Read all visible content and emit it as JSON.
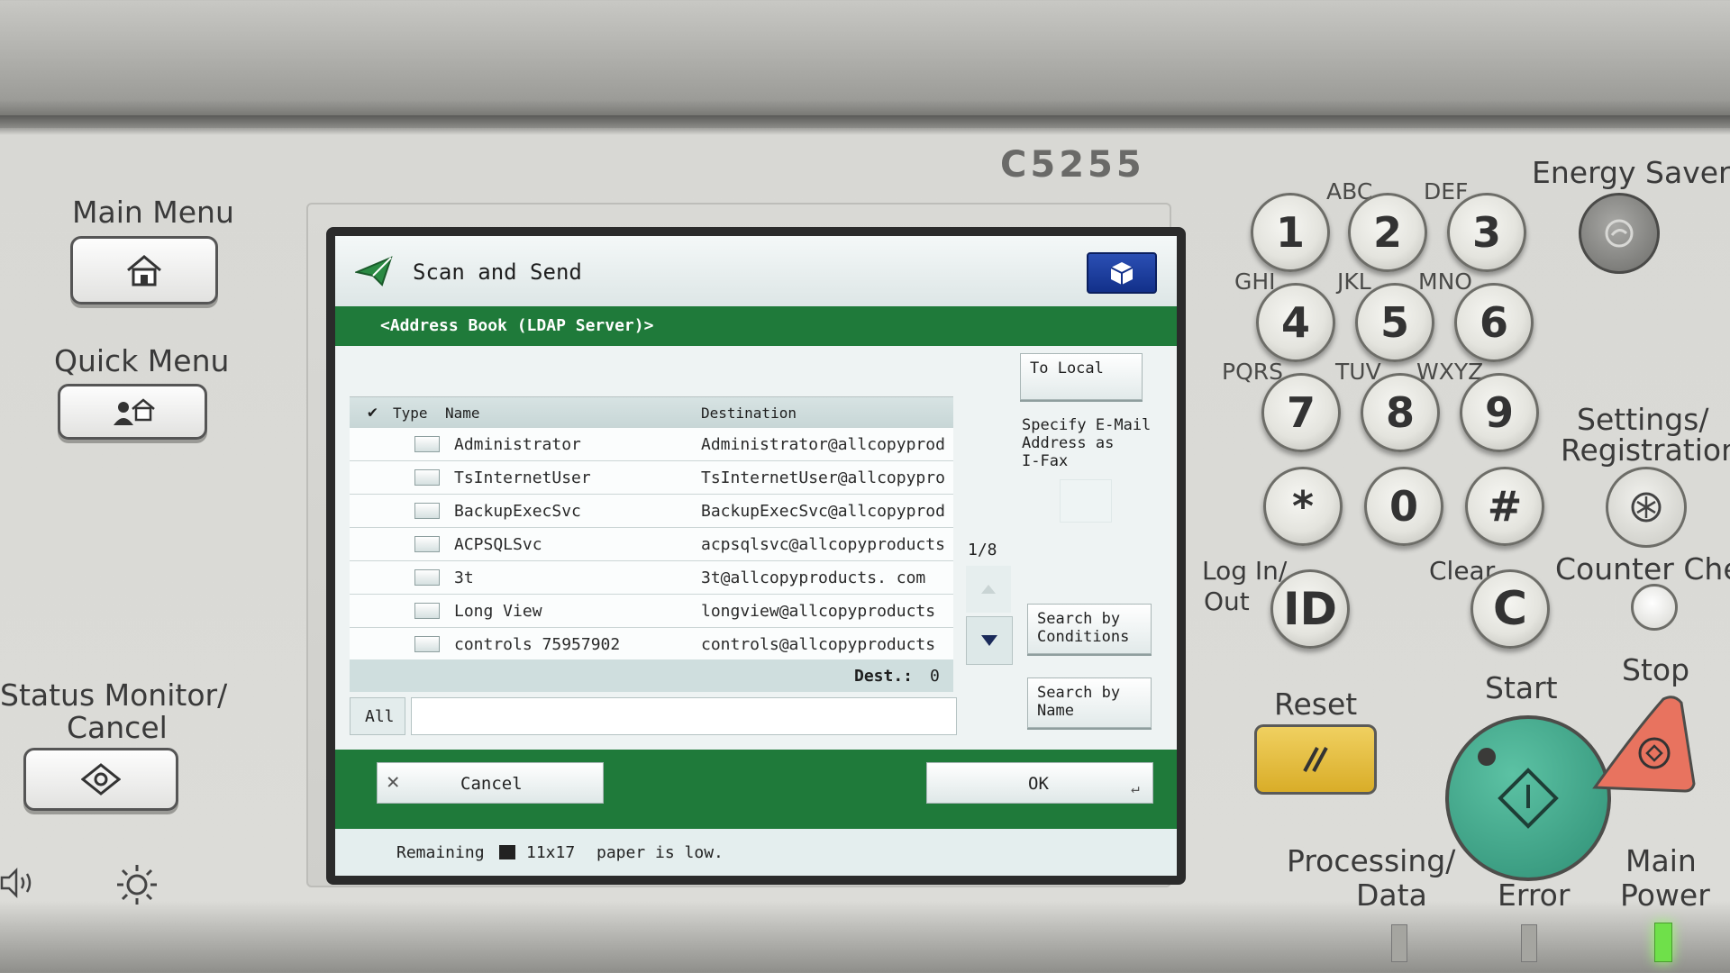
{
  "model": "C5255",
  "left_panel": {
    "main_menu": "Main Menu",
    "quick_menu": "Quick Menu",
    "status_monitor": "Status Monitor/",
    "status_cancel": "Cancel"
  },
  "screen": {
    "title": "Scan and Send",
    "section": "<Address Book (LDAP Server)>",
    "columns": {
      "check": "✔",
      "type": "Type",
      "name": "Name",
      "destination": "Destination"
    },
    "rows": [
      {
        "name": "Administrator",
        "destination": "Administrator@allcopyprod"
      },
      {
        "name": "TsInternetUser",
        "destination": "TsInternetUser@allcopypro"
      },
      {
        "name": "BackupExecSvc",
        "destination": "BackupExecSvc@allcopyprod"
      },
      {
        "name": "ACPSQLSvc",
        "destination": "acpsqlsvc@allcopyproducts"
      },
      {
        "name": "3t",
        "destination": "3t@allcopyproducts. com"
      },
      {
        "name": "Long View",
        "destination": "longview@allcopyproducts"
      },
      {
        "name": "controls 75957902",
        "destination": "controls@allcopyproducts"
      }
    ],
    "page_indicator": "1/8",
    "dest_label": "Dest.:",
    "dest_count": "0",
    "filter_label": "All",
    "to_local": "To Local",
    "specify_email_1": "Specify E-Mail",
    "specify_email_2": "Address as",
    "specify_email_3": "I-Fax",
    "search_conditions_1": "Search by",
    "search_conditions_2": "Conditions",
    "search_name_1": "Search by",
    "search_name_2": "Name",
    "cancel_label": "Cancel",
    "ok_label": "OK",
    "status_remaining": "Remaining",
    "status_paper": "11x17",
    "status_message": "paper is low."
  },
  "keypad": {
    "keys": [
      "1",
      "2",
      "3",
      "4",
      "5",
      "6",
      "7",
      "8",
      "9",
      "*",
      "0",
      "#"
    ],
    "letters": [
      "ABC",
      "DEF",
      "GHI",
      "JKL",
      "MNO",
      "PQRS",
      "TUV",
      "WXYZ"
    ]
  },
  "right_panel": {
    "energy_saver": "Energy Saver",
    "settings_1": "Settings/",
    "settings_2": "Registration",
    "log_in_1": "Log In/",
    "log_in_2": "Out",
    "id_label": "ID",
    "clear": "Clear",
    "clear_key": "C",
    "counter_check": "Counter Chec",
    "reset": "Reset",
    "start": "Start",
    "stop": "Stop",
    "processing_1": "Processing/",
    "processing_2": "Data",
    "error": "Error",
    "main_power_1": "Main",
    "main_power_2": "Power"
  },
  "colors": {
    "screen_green": "#1f7a3a",
    "start_green": "#3aa588",
    "stop_red": "#e8735f",
    "reset_yellow": "#e6c23d",
    "power_led": "#6fe04a"
  }
}
